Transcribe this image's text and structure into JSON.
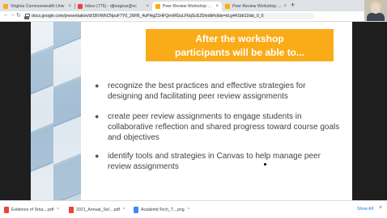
{
  "tabs": [
    {
      "title": "Virginia Commonwealth Univ",
      "close": "×",
      "active": false
    },
    {
      "title": "Inbox (775) - djburgess@vc",
      "close": "×",
      "active": false
    },
    {
      "title": "Peer Review Workshop Prese",
      "close": "×",
      "active": true
    },
    {
      "title": "Peer Review Workshop - Mar",
      "close": "×",
      "active": false
    }
  ],
  "new_tab": "+",
  "nav": {
    "back": "←",
    "forward": "→",
    "reload": "↻"
  },
  "address": {
    "url": "docs.google.com/presentation/d/1BVWhCNpuF7Y0_26FB_4uPHgZ1HFQmrRGuLF6qScEZ0/edit#slide=id.g441bb11fab_0_6"
  },
  "slide": {
    "header_line1": "After the workshop",
    "header_line2": "participants will be able to...",
    "bullet_char": "●",
    "bullets": [
      {
        "line1": "recognize the best practices and effective strategies for",
        "line2": "designing and facilitating peer review assignments"
      },
      {
        "line1": "create peer review assignments to engage students in",
        "line2": "collaborative reflection and shared progress toward course goals",
        "line3": "and objectives"
      },
      {
        "line1": "identify tools and strategies in Canvas to help manage peer",
        "line2": "review assignments"
      }
    ]
  },
  "downloads": [
    {
      "name": "Evidence of Sma....pdf",
      "chevron": "^",
      "type": "pdf"
    },
    {
      "name": "2021_Annual_Sel....pdf",
      "chevron": "^",
      "type": "pdf"
    },
    {
      "name": "AcademicTech_T....png",
      "chevron": "^",
      "type": "png"
    }
  ],
  "show_all": "Show All",
  "close_downloads": "×",
  "colors": {
    "accent": "#f9ab18",
    "slide_bg": "#ffffff",
    "stage_bg": "#1e1e1e"
  }
}
